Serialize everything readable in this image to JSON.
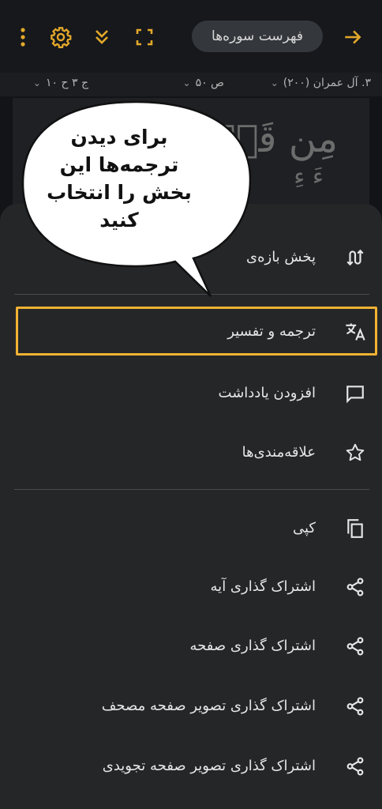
{
  "toolbar": {
    "surah_list_label": "فهرست سوره‌ها",
    "icons": [
      "arrow-forward-icon",
      "fullscreen-icon",
      "double-chevron-down-icon",
      "gear-icon",
      "more-vertical-icon"
    ]
  },
  "infobar": {
    "surah": "۳. آل عمران (۲۰۰)",
    "page": "ص ۵۰",
    "juz": "ج ۳ ح ۱۰"
  },
  "quran_text": {
    "line1": "مِن قَبۡلُ",
    "line2": "ءَ ءِ"
  },
  "tooltip": {
    "lines": [
      "برای دیدن",
      "ترجمه‌ها این",
      "بخش را انتخاب",
      "کنید"
    ],
    "border_color": "#f2b233"
  },
  "menu": {
    "items": [
      {
        "label": "پخش بازه‌ی",
        "icon": "playlist-repeat-icon"
      },
      {
        "label": "ترجمه و تفسیر",
        "icon": "translate-icon"
      },
      {
        "label": "افزودن یادداشت",
        "icon": "note-icon"
      },
      {
        "label": "علاقه‌مندی‌ها",
        "icon": "star-icon"
      },
      {
        "label": "کپی",
        "icon": "copy-icon"
      },
      {
        "label": "اشتراک گذاری آیه",
        "icon": "share-icon"
      },
      {
        "label": "اشتراک گذاری صفحه",
        "icon": "share-icon"
      },
      {
        "label": "اشتراک گذاری تصویر صفحه مصحف",
        "icon": "share-icon"
      },
      {
        "label": "اشتراک گذاری تصویر صفحه تجویدی",
        "icon": "share-icon"
      }
    ]
  },
  "colors": {
    "accent": "#e3a82a",
    "sheet_bg": "#252628",
    "highlight": "#f2b233"
  }
}
